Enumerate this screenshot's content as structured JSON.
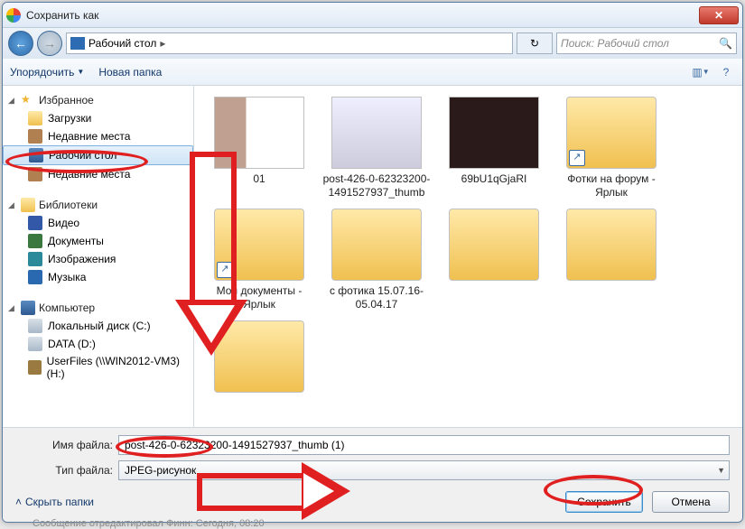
{
  "window": {
    "title": "Сохранить как"
  },
  "nav": {
    "path_icon": "desktop-icon",
    "path": "Рабочий стол",
    "path_sep": "▸",
    "refresh": "↻",
    "search_placeholder": "Поиск: Рабочий стол",
    "search_icon": "🔍"
  },
  "toolbar": {
    "organize": "Упорядочить",
    "newfolder": "Новая папка",
    "help": "?"
  },
  "tree": {
    "favorites": {
      "label": "Избранное",
      "items": [
        {
          "label": "Загрузки",
          "icon": "ico-folder"
        },
        {
          "label": "Недавние места",
          "icon": "ico-recent"
        },
        {
          "label": "Рабочий стол",
          "icon": "ico-monitor",
          "selected": true
        },
        {
          "label": "Недавние места",
          "icon": "ico-recent"
        }
      ]
    },
    "libraries": {
      "label": "Библиотеки",
      "items": [
        {
          "label": "Видео",
          "icon": "ico-video"
        },
        {
          "label": "Документы",
          "icon": "ico-doc"
        },
        {
          "label": "Изображения",
          "icon": "ico-pic"
        },
        {
          "label": "Музыка",
          "icon": "ico-music"
        }
      ]
    },
    "computer": {
      "label": "Компьютер",
      "items": [
        {
          "label": "Локальный диск (C:)",
          "icon": "ico-disk"
        },
        {
          "label": "DATA (D:)",
          "icon": "ico-disk"
        },
        {
          "label": "UserFiles (\\\\WIN2012-VM3) (H:)",
          "icon": "ico-net"
        }
      ]
    }
  },
  "files": [
    {
      "label": "01",
      "cls": "p01"
    },
    {
      "label": "post-426-0-62323200-1491527937_thumb",
      "cls": "p02"
    },
    {
      "label": "69bU1qGjaRI",
      "cls": "p03"
    },
    {
      "label": "Фотки на форум - Ярлык",
      "cls": "fold shortcut"
    },
    {
      "label": "Мои документы - Ярлык",
      "cls": "fold shortcut"
    },
    {
      "label": "с фотика 15.07.16-05.04.17",
      "cls": "fold"
    },
    {
      "label": "",
      "cls": "fold"
    },
    {
      "label": "",
      "cls": "fold"
    },
    {
      "label": "",
      "cls": "fold"
    }
  ],
  "form": {
    "filename_label": "Имя файла:",
    "filename_value": "post-426-0-62323200-1491527937_thumb (1)",
    "filetype_label": "Тип файла:",
    "filetype_value": "JPEG-рисунок"
  },
  "actions": {
    "hide": "Скрыть папки",
    "save": "Сохранить",
    "cancel": "Отмена"
  },
  "footer_note": "Сообщение отредактировал Финн: Сегодня, 08:20"
}
